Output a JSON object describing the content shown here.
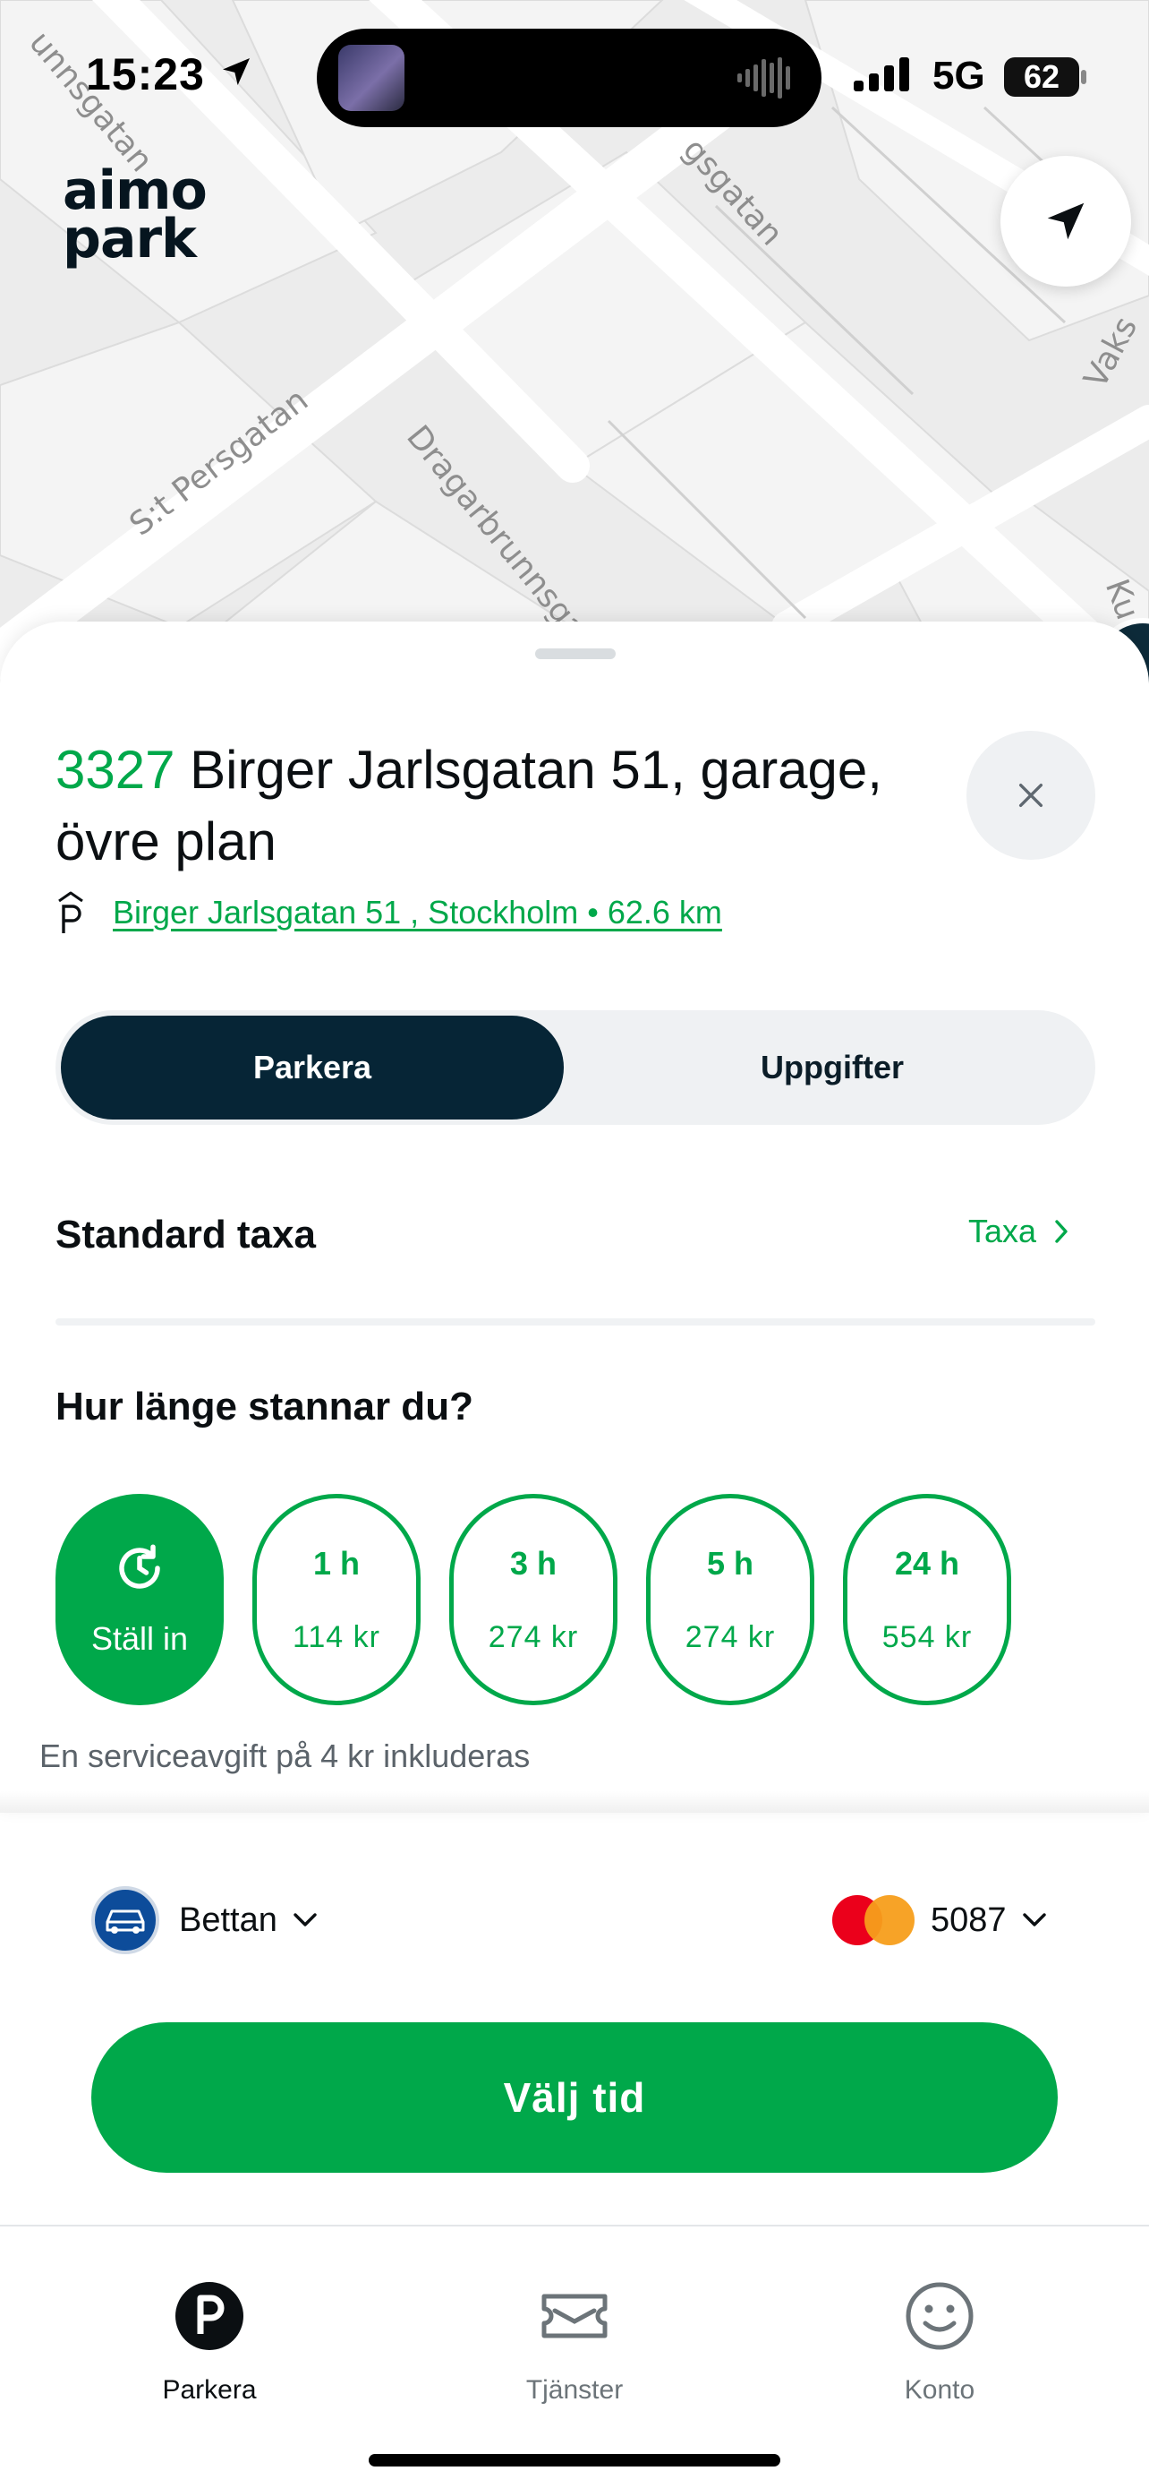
{
  "status_bar": {
    "time": "15:23",
    "network": "5G",
    "battery": "62"
  },
  "map": {
    "logo_line1": "aimo",
    "logo_line2": "park",
    "street_labels": [
      "unnsgatan",
      "gsgatan",
      "S:t Persgatan",
      "Dragarbrunnsgatan",
      "Vaks",
      "Ku"
    ]
  },
  "location": {
    "code": "3327",
    "name": "Birger Jarlsgatan 51, garage, övre plan",
    "address_link": "Birger Jarlsgatan 51 , Stockholm • 62.6 km"
  },
  "segmented": {
    "active_label": "Parkera",
    "inactive_label": "Uppgifter"
  },
  "rate": {
    "label": "Standard taxa",
    "link_label": "Taxa"
  },
  "duration": {
    "question": "Hur länge stannar du?",
    "custom_label": "Ställ in",
    "options": [
      {
        "duration": "1 h",
        "price": "114  kr"
      },
      {
        "duration": "3 h",
        "price": "274  kr"
      },
      {
        "duration": "5 h",
        "price": "274  kr"
      },
      {
        "duration": "24 h",
        "price": "554  kr"
      }
    ],
    "fee_note": "En serviceavgift på 4  kr inkluderas"
  },
  "vehicle": {
    "name": "Bettan"
  },
  "payment": {
    "card_last4": "5087"
  },
  "cta": {
    "label": "Välj tid"
  },
  "tabs": [
    {
      "label": "Parkera",
      "icon": "parking-icon",
      "active": true
    },
    {
      "label": "Tjänster",
      "icon": "ticket-icon",
      "active": false
    },
    {
      "label": "Konto",
      "icon": "smiley-icon",
      "active": false
    }
  ],
  "colors": {
    "accent_green": "#00a84a",
    "navy": "#062536",
    "map_bg": "#ececec"
  }
}
